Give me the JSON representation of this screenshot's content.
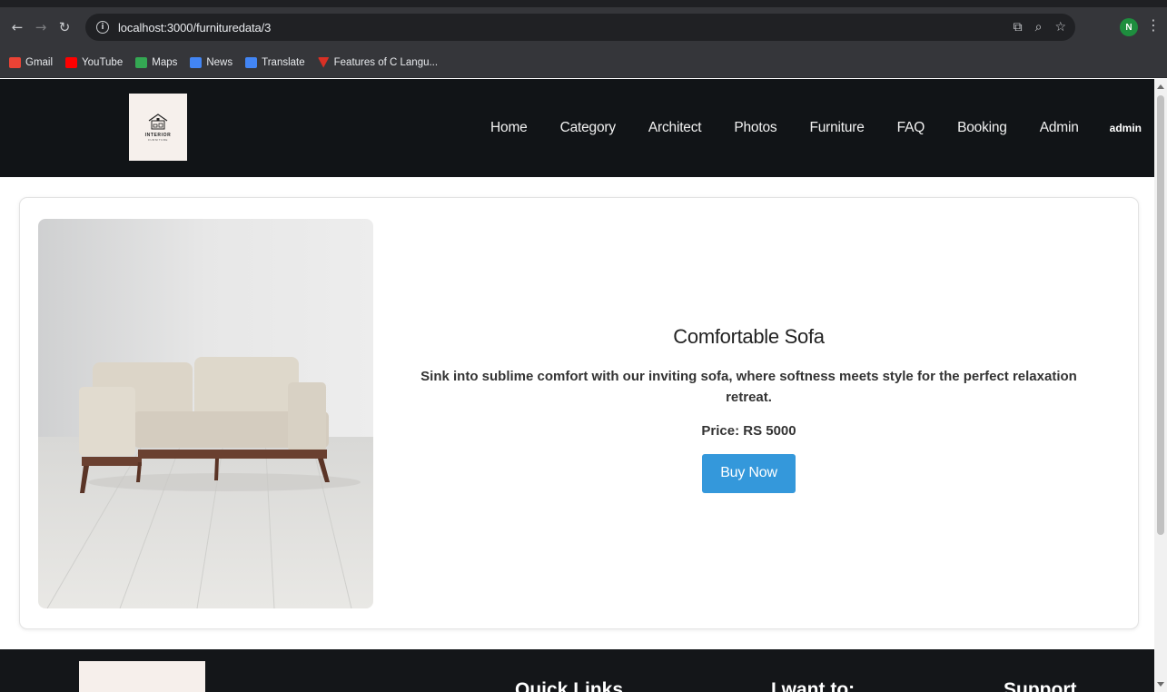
{
  "browser": {
    "url": "localhost:3000/furnituredata/3",
    "profile_initial": "N",
    "bookmarks": [
      {
        "label": "Gmail",
        "color": "#ea4335"
      },
      {
        "label": "YouTube",
        "color": "#ff0000"
      },
      {
        "label": "Maps",
        "color": "#34a853"
      },
      {
        "label": "News",
        "color": "#4285f4"
      },
      {
        "label": "Translate",
        "color": "#4285f4"
      },
      {
        "label": "Features of C Langu...",
        "color": "#d93025"
      }
    ]
  },
  "header": {
    "logo_text": "INTERIOR",
    "logo_sub": "FURNITURE",
    "nav": [
      "Home",
      "Category",
      "Architect",
      "Photos",
      "Furniture",
      "FAQ",
      "Booking",
      "Admin"
    ],
    "user": "admin"
  },
  "product": {
    "title": "Comfortable Sofa",
    "description": "Sink into sublime comfort with our inviting sofa, where softness meets style for the perfect relaxation retreat.",
    "price": "Price: RS 5000",
    "buy_label": "Buy Now"
  },
  "footer": {
    "headings": [
      "Quick Links",
      "I want to:",
      "Support"
    ]
  },
  "colors": {
    "header_bg": "#111417",
    "button": "#3498db",
    "footer_bg": "#141619"
  }
}
